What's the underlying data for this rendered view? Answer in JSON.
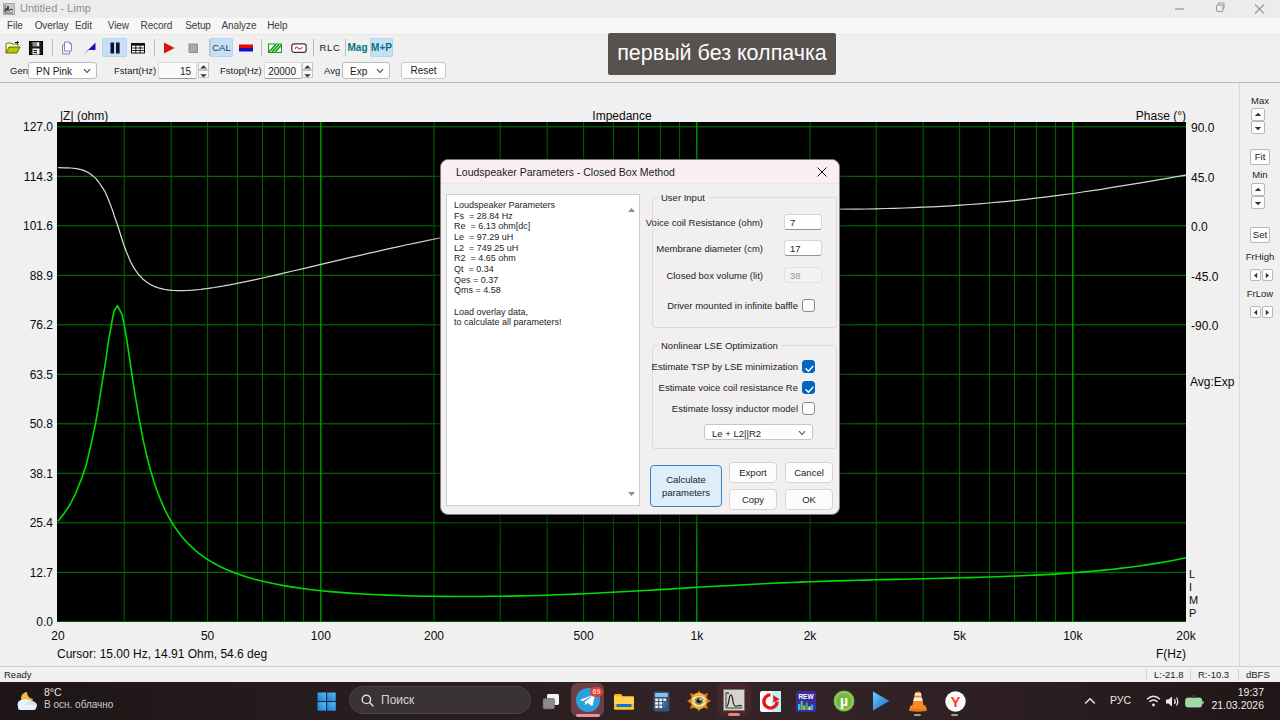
{
  "window": {
    "title": "Untitled - Limp",
    "minimize": "minimize",
    "restore": "restore",
    "close": "close"
  },
  "menu": {
    "items": [
      {
        "label": "File",
        "x": 7
      },
      {
        "label": "Overlay",
        "x": 34.7
      },
      {
        "label": "Edit",
        "x": 75
      },
      {
        "label": "View",
        "x": 107.8
      },
      {
        "label": "Record",
        "x": 140.6
      },
      {
        "label": "Setup",
        "x": 185.2
      },
      {
        "label": "Analyze",
        "x": 221.5
      },
      {
        "label": "Help",
        "x": 267.2
      }
    ]
  },
  "toolbar": {
    "cal_label": "CAL",
    "rlc_label": "RLC",
    "mag_label": "Mag",
    "mp_label": "M+P",
    "items": [
      "open-file",
      "save",
      "copy",
      "overlay-flag",
      "pause",
      "table-view",
      "record-play",
      "stop",
      "calibrate",
      "generator-setup",
      "spectrum",
      "signal-generator",
      "rlc-meter",
      "magnitude",
      "magnitude-phase"
    ],
    "selected_items": [
      "pause",
      "calibrate",
      "magnitude-phase"
    ]
  },
  "gen_controls": {
    "gen_label": "Gen",
    "gen_value": "PN Pink",
    "fstart_label": "Fstart(Hz)",
    "fstart_value": "15",
    "fstop_label": "Fstop(Hz)",
    "fstop_value": "20000",
    "avg_label": "Avg",
    "avg_value": "Exp",
    "reset_label": "Reset"
  },
  "overlay_note": {
    "text": "первый без колпачка"
  },
  "chart": {
    "title": "Impedance",
    "y_left_title": "|Z| (ohm)",
    "y_right_title": "Phase (°)",
    "x_axis_title": "F(Hz)",
    "avg_indicator": "Avg:Exp",
    "watermark": [
      "L",
      "I",
      "M",
      "P"
    ],
    "cursor_text": "Cursor: 15.00 Hz, 14.91 Ohm, 54.6 deg",
    "y_left_ticks": [
      "127.0",
      "114.3",
      "101.6",
      "88.9",
      "76.2",
      "63.5",
      "50.8",
      "38.1",
      "25.4",
      "12.7",
      "0.0"
    ],
    "y_right_ticks": [
      "90.0",
      "45.0",
      "0.0",
      "-45.0",
      "-90.0"
    ],
    "x_ticks": [
      {
        "label": "20",
        "f": 20
      },
      {
        "label": "50",
        "f": 50
      },
      {
        "label": "100",
        "f": 100
      },
      {
        "label": "200",
        "f": 200
      },
      {
        "label": "500",
        "f": 500
      },
      {
        "label": "1k",
        "f": 1000
      },
      {
        "label": "2k",
        "f": 2000
      },
      {
        "label": "5k",
        "f": 5000
      },
      {
        "label": "10k",
        "f": 10000
      },
      {
        "label": "20k",
        "f": 20000
      }
    ]
  },
  "chart_data": {
    "type": "line",
    "xscale": "log",
    "x_range_hz": [
      20,
      20000
    ],
    "z_range_ohm": [
      0,
      127
    ],
    "phase_range_deg": [
      -90,
      90
    ],
    "grid_minor_hz": [
      30,
      40,
      50,
      60,
      70,
      80,
      90,
      200,
      300,
      400,
      500,
      600,
      700,
      800,
      900,
      2000,
      3000,
      4000,
      5000,
      6000,
      7000,
      8000,
      9000
    ],
    "grid_major_hz": [
      100,
      1000,
      10000
    ],
    "series": [
      {
        "name": "impedance_ohm",
        "color": "#00dc00",
        "x": [
          20.0,
          20.8,
          21.2,
          21.6,
          22.4,
          22.4,
          23.2,
          23.8,
          24.0,
          24.8,
          25.2,
          25.6,
          26.4,
          26.7,
          27.2,
          28.0,
          28.2,
          28.8,
          29.6,
          29.9,
          30.4,
          31.2,
          31.7,
          32.0,
          32.8,
          33.6,
          33.6,
          34.4,
          35.2,
          35.6,
          36.0,
          36.8,
          37.6,
          37.7,
          38.4,
          39.2,
          39.9,
          40.0,
          40.8,
          41.6,
          42.3,
          42.4,
          43.2,
          44.0,
          44.8,
          44.8,
          45.6,
          46.4,
          47.2,
          47.4,
          48.0,
          48.8,
          49.6,
          50.2,
          50.4,
          51.2,
          52.0,
          52.8,
          53.2,
          53.6,
          54.4,
          55.2,
          56.0,
          56.4,
          56.8,
          57.6,
          58.4,
          59.2,
          59.7,
          63.2,
          67.0,
          71.0,
          75.2,
          79.6,
          84.3,
          89.3,
          94.6,
          100.2,
          106.2,
          112.5,
          119.1,
          126.2,
          133.7,
          141.6,
          150.0,
          158.9,
          168.3,
          178.2,
          188.8,
          200.0,
          211.8,
          224.4,
          237.7,
          251.8,
          266.7,
          282.5,
          299.2,
          317.0,
          335.8,
          355.7,
          376.7,
          399.1,
          422.7,
          447.7,
          474.3,
          502.4,
          532.1,
          563.7,
          597.1,
          632.5,
          669.9,
          709.6,
          751.7,
          796.2,
          843.4,
          893.4,
          946.3,
          1002.4,
          1061.8,
          1124.7,
          1191.3,
          1261.9,
          1336.7,
          1415.9,
          1499.8,
          1588.7,
          1682.8,
          1782.5,
          1888.1,
          2000.0,
          2118.5,
          2244.0,
          2377.0,
          2517.8,
          2667.0,
          2825.1,
          2992.5,
          3169.8,
          3357.6,
          3556.6,
          3767.3,
          3990.5,
          4227.0,
          4477.4,
          4742.8,
          5023.8,
          5321.4,
          5636.8,
          5970.8,
          6324.6,
          6699.3,
          7096.3,
          7516.8,
          7962.1,
          8433.9,
          8933.7,
          9463.0,
          10023.7,
          10617.7,
          11246.8,
          11913.2,
          12619.1,
          13366.9,
          14158.9,
          14997.9,
          15886.6,
          16827.9,
          17825.0,
          18881.2,
          20000.0
        ],
        "y": [
          25.79,
          27.94,
          29.06,
          30.35,
          33.33,
          33.5,
          37.12,
          40.43,
          41.92,
          47.87,
          51.13,
          55.04,
          63.23,
          66.11,
          71.62,
          78.37,
          79.75,
          81.13,
          78.9,
          76.87,
          73.05,
          65.81,
          61.32,
          58.75,
          52.49,
          47.31,
          47.18,
          42.73,
          39.01,
          37.49,
          35.87,
          33.21,
          30.93,
          30.75,
          28.97,
          27.26,
          25.92,
          25.76,
          24.44,
          23.27,
          22.38,
          22.22,
          21.27,
          20.42,
          19.68,
          19.65,
          18.95,
          18.31,
          17.72,
          17.56,
          17.18,
          16.67,
          16.21,
          15.86,
          15.78,
          15.38,
          15.0,
          14.65,
          14.48,
          14.32,
          14.02,
          13.73,
          13.45,
          13.33,
          13.2,
          12.95,
          12.72,
          12.5,
          12.37,
          11.56,
          10.86,
          10.26,
          9.74,
          9.29,
          8.89,
          8.55,
          8.24,
          7.98,
          7.74,
          7.54,
          7.36,
          7.2,
          7.06,
          6.94,
          6.84,
          6.76,
          6.68,
          6.62,
          6.58,
          6.54,
          6.51,
          6.5,
          6.49,
          6.49,
          6.5,
          6.53,
          6.56,
          6.59,
          6.64,
          6.7,
          6.76,
          6.83,
          6.92,
          7.0,
          7.1,
          7.21,
          7.32,
          7.44,
          7.56,
          7.69,
          7.83,
          7.97,
          8.11,
          8.26,
          8.4,
          8.55,
          8.7,
          8.84,
          8.99,
          9.13,
          9.26,
          9.4,
          9.53,
          9.65,
          9.77,
          9.88,
          9.98,
          10.08,
          10.18,
          10.27,
          10.35,
          10.43,
          10.5,
          10.58,
          10.64,
          10.71,
          10.77,
          10.82,
          10.88,
          10.94,
          10.99,
          11.05,
          11.11,
          11.16,
          11.22,
          11.29,
          11.35,
          11.42,
          11.5,
          11.58,
          11.67,
          11.76,
          11.87,
          11.98,
          12.11,
          12.25,
          12.4,
          12.57,
          12.75,
          12.96,
          13.18,
          13.42,
          13.69,
          13.99,
          14.31,
          14.67,
          15.06,
          15.48,
          15.94,
          16.45
        ]
      },
      {
        "name": "phase_deg",
        "color": "#d6d6d6",
        "x": [
          20.0,
          20.8,
          21.2,
          21.6,
          22.4,
          22.4,
          23.2,
          23.8,
          24.0,
          24.8,
          25.2,
          25.6,
          26.4,
          26.7,
          27.2,
          28.0,
          28.2,
          28.8,
          29.6,
          29.9,
          30.4,
          31.2,
          31.7,
          32.0,
          32.8,
          33.6,
          33.6,
          34.4,
          35.2,
          35.6,
          36.0,
          36.8,
          37.6,
          37.7,
          38.4,
          39.2,
          39.9,
          40.0,
          40.8,
          41.6,
          42.3,
          42.4,
          43.2,
          44.0,
          44.8,
          44.8,
          45.6,
          46.4,
          47.2,
          47.4,
          48.0,
          48.8,
          49.6,
          50.2,
          50.4,
          51.2,
          52.0,
          52.8,
          53.2,
          53.6,
          54.4,
          55.2,
          56.0,
          56.4,
          56.8,
          57.6,
          58.4,
          59.2,
          59.7,
          63.2,
          67.0,
          71.0,
          75.2,
          79.6,
          84.3,
          89.3,
          94.6,
          100.2,
          106.2,
          112.5,
          119.1,
          126.2,
          133.7,
          141.6,
          150.0,
          158.9,
          168.3,
          178.2,
          188.8,
          200.0,
          211.8,
          224.4,
          237.7,
          251.8,
          266.7,
          282.5,
          299.2,
          317.0,
          335.8,
          355.7,
          376.7,
          399.1,
          422.7,
          447.7,
          474.3,
          502.4,
          532.1,
          563.7,
          597.1,
          632.5,
          669.9,
          709.6,
          751.7,
          796.2,
          843.4,
          893.4,
          946.3,
          1002.4,
          1061.8,
          1124.7,
          1191.3,
          1261.9,
          1336.7,
          1415.9,
          1499.8,
          1588.7,
          1682.8,
          1782.5,
          1888.1,
          2000.0,
          2118.5,
          2244.0,
          2377.0,
          2517.8,
          2667.0,
          2825.1,
          2992.5,
          3169.8,
          3357.6,
          3556.6,
          3767.3,
          3990.5,
          4227.0,
          4477.4,
          4742.8,
          5023.8,
          5321.4,
          5636.8,
          5970.8,
          6324.6,
          6699.3,
          7096.3,
          7516.8,
          7962.1,
          8433.9,
          8933.7,
          9463.0,
          10023.7,
          10617.7,
          11246.8,
          11913.2,
          12619.1,
          13366.9,
          14158.9,
          14997.9,
          15886.6,
          16827.9,
          17825.0,
          18881.2,
          20000.0
        ],
        "y": [
          52.8,
          52.7,
          52.6,
          52.5,
          51.9,
          51.9,
          50.8,
          49.3,
          48.6,
          45.2,
          43.1,
          40.3,
          33.5,
          30.7,
          24.4,
          13.2,
          9.4,
          0.7,
          -12.3,
          -17.0,
          -23.6,
          -32.6,
          -37.1,
          -39.4,
          -44.5,
          -48.3,
          -48.3,
          -51.2,
          -53.4,
          -54.2,
          -55.0,
          -56.2,
          -57.1,
          -57.2,
          -57.8,
          -58.3,
          -58.6,
          -58.6,
          -58.8,
          -58.9,
          -58.9,
          -58.9,
          -58.9,
          -58.8,
          -58.7,
          -58.6,
          -58.5,
          -58.2,
          -58.0,
          -57.9,
          -57.7,
          -57.4,
          -57.1,
          -56.8,
          -56.8,
          -56.4,
          -56.1,
          -55.7,
          -55.6,
          -55.4,
          -55.0,
          -54.6,
          -54.2,
          -54.1,
          -53.9,
          -53.5,
          -53.1,
          -52.7,
          -52.4,
          -50.7,
          -48.9,
          -47.0,
          -45.1,
          -43.1,
          -41.1,
          -39.1,
          -37.1,
          -35.1,
          -33.1,
          -31.0,
          -29.0,
          -27.1,
          -25.1,
          -23.2,
          -21.3,
          -19.4,
          -17.5,
          -15.7,
          -14.0,
          -12.2,
          -10.5,
          -8.8,
          -7.2,
          -5.6,
          -4.0,
          -2.5,
          -1.0,
          0.4,
          1.7,
          2.9,
          4.1,
          5.3,
          6.4,
          7.4,
          8.4,
          9.3,
          10.2,
          11.0,
          11.7,
          12.4,
          12.9,
          13.5,
          13.9,
          14.3,
          14.6,
          14.9,
          15.1,
          15.2,
          15.3,
          15.4,
          15.4,
          15.4,
          15.4,
          15.4,
          15.3,
          15.2,
          15.2,
          15.1,
          15.1,
          15.1,
          15.0,
          15.0,
          15.1,
          15.1,
          15.2,
          15.3,
          15.5,
          15.7,
          15.9,
          16.2,
          16.5,
          16.9,
          17.3,
          17.7,
          18.2,
          18.8,
          19.4,
          20.0,
          20.7,
          21.5,
          22.3,
          23.2,
          24.1,
          25.1,
          26.1,
          27.2,
          28.3,
          29.4,
          30.7,
          31.9,
          33.2,
          34.6,
          36.0,
          37.4,
          38.8,
          40.2,
          41.7,
          43.2,
          44.7,
          46.2
        ]
      }
    ]
  },
  "right_panel": {
    "max_label": "Max",
    "fit_label": "Fit",
    "min_label": "Min",
    "set_label": "Set",
    "frhigh_label": "FrHigh",
    "frlow_label": "FrLow"
  },
  "statusbar": {
    "ready": "Ready",
    "left_level": "L:-21.8",
    "right_level": "R:-10.3",
    "unit": "dBFS"
  },
  "dialog": {
    "title": "Loudspeaker Parameters - Closed Box Method",
    "results_text": "Loudspeaker Parameters\nFs  = 28.84 Hz\nRe  = 6.13 ohm[dc]\nLe  = 97.29 uH\nL2  = 749.25 uH\nR2  = 4.65 ohm\nQt  = 0.34\nQes = 0.37\nQms = 4.58\n\nLoad overlay data,\nto calculate all parameters!",
    "group1_label": "User Input",
    "voice_coil_label": "Voice coil Resistance (ohm)",
    "voice_coil_value": "7",
    "membrane_label": "Membrane diameter (cm)",
    "membrane_value": "17",
    "box_volume_label": "Closed box volume (lit)",
    "box_volume_value": "38",
    "baffle_label": "Driver mounted in infinite baffle",
    "baffle_checked": false,
    "group2_label": "Nonlinear LSE Optimization",
    "tsp_label": "Estimate TSP by LSE minimization",
    "tsp_checked": true,
    "re_label": "Estimate voice coil resistance Re",
    "re_checked": true,
    "lossy_label": "Estimate lossy inductor model",
    "lossy_checked": false,
    "inductor_model_value": "Le + L2||R2",
    "calc_label": "Calculate\nparameters",
    "export_label": "Export",
    "cancel_label": "Cancel",
    "copy_label": "Copy",
    "ok_label": "OK"
  },
  "taskbar": {
    "weather_temp": "8°C",
    "weather_desc": "В осн. облачно",
    "search_placeholder": "Поиск",
    "telegram_badge": "69",
    "lang": "РУС",
    "time": "19:37",
    "date": "21.03.2026",
    "apps": [
      "task-view",
      "telegram",
      "file-explorer",
      "calculator",
      "viewer",
      "limp",
      "ccleaner",
      "rew",
      "utorrent",
      "media-player",
      "vlc",
      "yandex-browser"
    ]
  }
}
